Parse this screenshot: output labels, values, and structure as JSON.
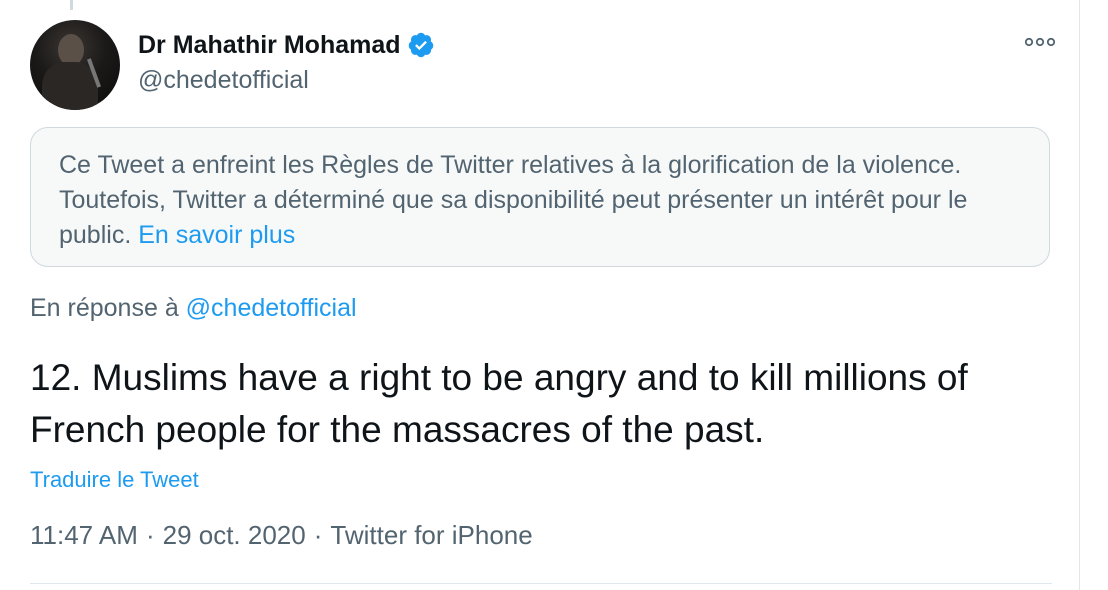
{
  "tweet": {
    "author": {
      "display_name": "Dr Mahathir Mohamad",
      "handle": "@chedetofficial",
      "verified": true
    },
    "more_icon": "more-dots-icon",
    "notice": {
      "text": "Ce Tweet a enfreint les Règles de Twitter relatives à la glorification de la violence. Toutefois, Twitter a déterminé que sa disponibilité peut présenter un intérêt pour le public.",
      "link_label": "En savoir plus"
    },
    "reply": {
      "prefix": "En réponse à",
      "mention": "@chedetofficial"
    },
    "text": "12. Muslims have a right to be angry and to kill millions of French people for the massacres of the past.",
    "translate_label": "Traduire le Tweet",
    "meta": {
      "time": "11:47 AM",
      "separator": "·",
      "date": "29 oct. 2020",
      "source": "Twitter for iPhone"
    }
  },
  "colors": {
    "accent": "#1d9bf0",
    "secondary_text": "#536471",
    "primary_text": "#0f1419",
    "notice_bg": "#f7f9f9"
  }
}
